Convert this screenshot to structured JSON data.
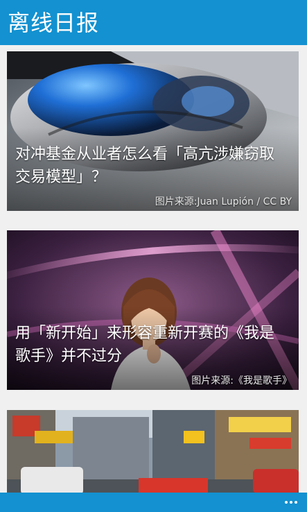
{
  "header": {
    "title": "离线日报"
  },
  "feed": {
    "cards": [
      {
        "title": "对冲基金从业者怎么看「高亢涉嫌窃取交易模型」？",
        "credit": "图片来源:Juan Lupión / CC BY",
        "image": "computer-mouse-photo"
      },
      {
        "title": "用「新开始」来形容重新开赛的《我是歌手》并不过分",
        "credit": "图片来源:《我是歌手》",
        "image": "singer-stage-photo"
      },
      {
        "title": "",
        "credit": "",
        "image": "city-street-photo"
      }
    ]
  },
  "appbar": {
    "more_icon": "ellipsis-icon"
  },
  "colors": {
    "accent": "#1391d0",
    "background": "#f0f0f0"
  }
}
